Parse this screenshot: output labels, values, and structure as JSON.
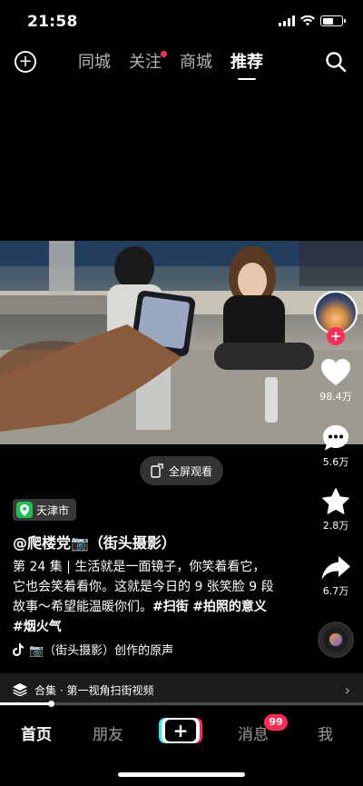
{
  "status_bar": {
    "time": "21:58"
  },
  "top_nav": {
    "tabs": [
      {
        "label": "同城",
        "active": false,
        "dot": false
      },
      {
        "label": "关注",
        "active": false,
        "dot": true
      },
      {
        "label": "商城",
        "active": false,
        "dot": false
      },
      {
        "label": "推荐",
        "active": true,
        "dot": false
      }
    ]
  },
  "video": {
    "fullscreen_label": "全屏观看"
  },
  "actions": {
    "like_count": "98.4万",
    "comment_count": "5.6万",
    "favorite_count": "2.8万",
    "share_count": "6.7万"
  },
  "post": {
    "location": "天津市",
    "author": "@爬楼党📷（街头摄影）",
    "episode": "第 24 集",
    "description": "生活就是一面镜子，你笑着看它，它也会笑着看你。这就是今日的 9 张笑脸 9 段故事～希望能温暖你们。",
    "hashtags": [
      "#扫街",
      "#拍照的意义",
      "#烟火气"
    ],
    "music": "📷（街头摄影）创作的原声"
  },
  "collection": {
    "label": "合集 · 第一视角扫街视频"
  },
  "playback": {
    "progress": 0.14
  },
  "bottom_nav": {
    "home": "首页",
    "friends": "朋友",
    "messages": "消息",
    "messages_badge": "99",
    "me": "我"
  },
  "colors": {
    "accent": "#fe2c55",
    "location_pin": "#1fbf4f"
  }
}
